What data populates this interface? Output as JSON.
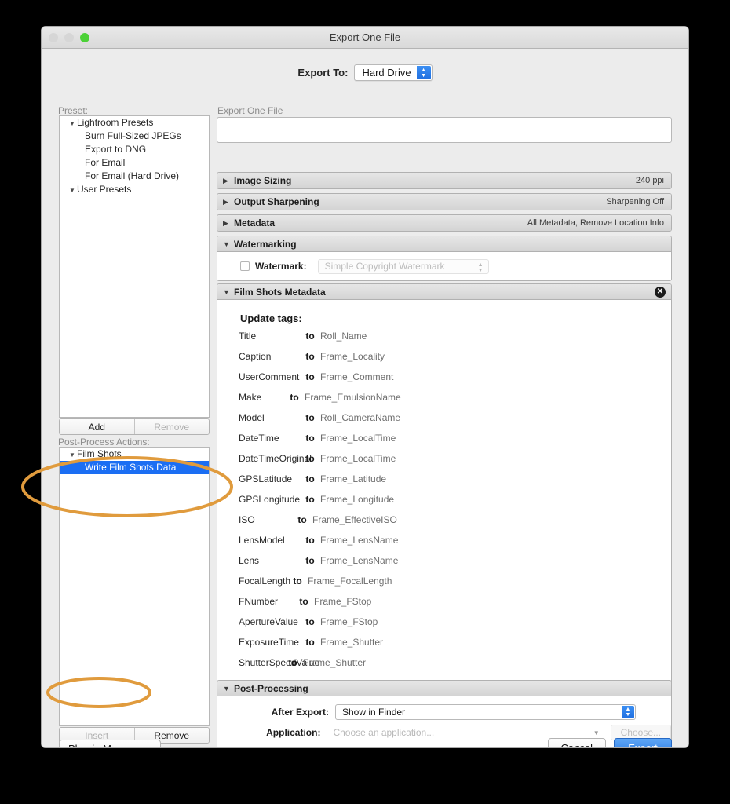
{
  "window": {
    "title": "Export One File",
    "traffic_lights": [
      "close-button",
      "minimize-button",
      "zoom-button"
    ]
  },
  "export_to": {
    "label": "Export To:",
    "value": "Hard Drive"
  },
  "left": {
    "preset_label": "Preset:",
    "preset_tree": [
      {
        "label": "Lightroom Presets",
        "type": "group",
        "expanded": true
      },
      {
        "label": "Burn Full-Sized JPEGs",
        "type": "child"
      },
      {
        "label": "Export to DNG",
        "type": "child"
      },
      {
        "label": "For Email",
        "type": "child"
      },
      {
        "label": "For Email (Hard Drive)",
        "type": "child"
      },
      {
        "label": "User Presets",
        "type": "group",
        "expanded": true
      }
    ],
    "preset_buttons": {
      "add": "Add",
      "remove": "Remove"
    },
    "post_process_label": "Post-Process Actions:",
    "post_process_tree": [
      {
        "label": "Film Shots",
        "type": "group",
        "expanded": true
      },
      {
        "label": "Write Film Shots Data",
        "type": "child",
        "selected": true
      }
    ],
    "action_buttons": {
      "insert": "Insert",
      "remove": "Remove"
    },
    "plugin_manager": "Plug-in Manager..."
  },
  "right": {
    "section_label": "Export One File",
    "panels": [
      {
        "title": "Image Sizing",
        "summary": "240 ppi",
        "expanded": false
      },
      {
        "title": "Output Sharpening",
        "summary": "Sharpening Off",
        "expanded": false
      },
      {
        "title": "Metadata",
        "summary": "All Metadata, Remove Location Info",
        "expanded": false
      }
    ],
    "watermarking": {
      "title": "Watermarking",
      "checkbox_label": "Watermark:",
      "checked": false,
      "popup_value": "Simple Copyright Watermark"
    },
    "film_shots_metadata": {
      "title": "Film Shots Metadata",
      "update_heading": "Update tags:",
      "to_word": "to",
      "rows": [
        {
          "tag": "Title",
          "value": "Roll_Name"
        },
        {
          "tag": "Caption",
          "value": "Frame_Locality"
        },
        {
          "tag": "UserComment",
          "value": "Frame_Comment"
        },
        {
          "tag": "Make",
          "value": "Frame_EmulsionName"
        },
        {
          "tag": "Model",
          "value": "Roll_CameraName"
        },
        {
          "tag": "DateTime",
          "value": "Frame_LocalTime"
        },
        {
          "tag": "DateTimeOriginal",
          "value": "Frame_LocalTime"
        },
        {
          "tag": "GPSLatitude",
          "value": "Frame_Latitude"
        },
        {
          "tag": "GPSLongitude",
          "value": "Frame_Longitude"
        },
        {
          "tag": "ISO",
          "value": "Frame_EffectiveISO"
        },
        {
          "tag": "LensModel",
          "value": "Frame_LensName"
        },
        {
          "tag": "Lens",
          "value": "Frame_LensName"
        },
        {
          "tag": "FocalLength",
          "value": "Frame_FocalLength"
        },
        {
          "tag": "FNumber",
          "value": "Frame_FStop"
        },
        {
          "tag": "ApertureValue",
          "value": "Frame_FStop"
        },
        {
          "tag": "ExposureTime",
          "value": "Frame_Shutter"
        },
        {
          "tag": "ShutterSpeedValue",
          "value": "Frame_Shutter"
        }
      ]
    },
    "post_processing": {
      "title": "Post-Processing",
      "after_export_label": "After Export:",
      "after_export_value": "Show in Finder",
      "application_label": "Application:",
      "application_placeholder": "Choose an application...",
      "choose_button": "Choose..."
    }
  },
  "footer": {
    "cancel": "Cancel",
    "export": "Export"
  },
  "annotations": {
    "color": "#e09b3d",
    "ellipses": [
      {
        "name": "highlight-write-film-shots-data"
      },
      {
        "name": "highlight-insert-button"
      }
    ]
  }
}
